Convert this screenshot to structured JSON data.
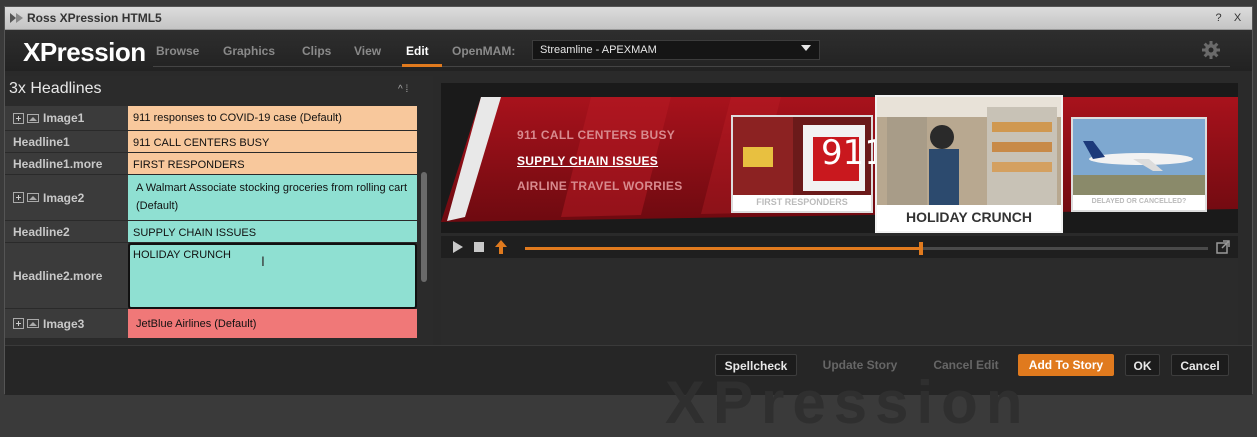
{
  "window": {
    "title": "Ross XPression HTML5",
    "help": "?",
    "close": "X"
  },
  "header": {
    "logo": "XPression",
    "menu": [
      "Browse",
      "Graphics",
      "Clips",
      "View",
      "Edit"
    ],
    "active_menu": "Edit",
    "openmam_label": "OpenMAM:",
    "openmam_value": "Streamline - APEXMAM"
  },
  "panel": {
    "title": "3x Headlines",
    "rows": [
      {
        "label": "Image1",
        "value": "911 responses to COVID-19 case (Default)"
      },
      {
        "label": "Headline1",
        "value": "911 CALL CENTERS BUSY"
      },
      {
        "label": "Headline1.more",
        "value": "FIRST RESPONDERS"
      },
      {
        "label": "Image2",
        "value": "A Walmart Associate stocking groceries from rolling cart (Default)"
      },
      {
        "label": "Headline2",
        "value": "SUPPLY CHAIN  ISSUES"
      },
      {
        "label": "Headline2.more",
        "value": "HOLIDAY CRUNCH"
      },
      {
        "label": "Image3",
        "value": "JetBlue Airlines (Default)"
      }
    ]
  },
  "preview": {
    "headlines": [
      "911 CALL CENTERS BUSY",
      "SUPPLY CHAIN  ISSUES",
      "AIRLINE TRAVEL WORRIES"
    ],
    "active_headline": "SUPPLY CHAIN  ISSUES",
    "thumb_captions": [
      "FIRST RESPONDERS",
      "HOLIDAY CRUNCH",
      "DELAYED OR CANCELLED?"
    ],
    "thumb1_text": "911",
    "playback_progress": 0.58
  },
  "buttons": {
    "spellcheck": "Spellcheck",
    "update_story": "Update Story",
    "cancel_edit": "Cancel Edit",
    "add_to_story": "Add To Story",
    "ok": "OK",
    "cancel": "Cancel"
  },
  "colors": {
    "accent": "#e07a1e",
    "field_orange": "#f8c89c",
    "field_teal": "#8fe0d2",
    "field_red": "#f07878",
    "graphic_red": "#8b0d14"
  }
}
